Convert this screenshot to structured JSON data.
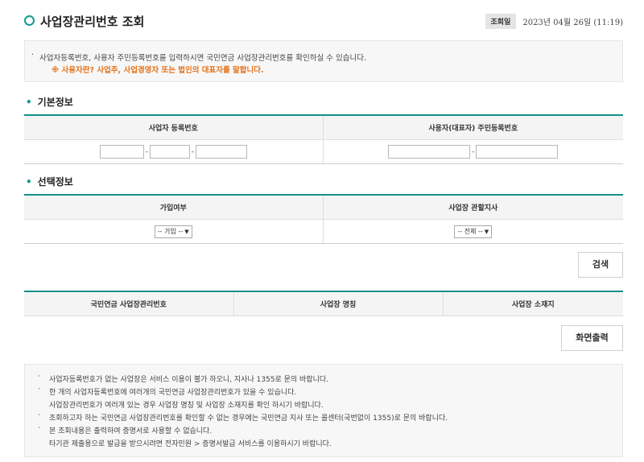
{
  "header": {
    "title": "사업장관리번호 조회",
    "meta_label": "조회일",
    "meta_date": "2023년 04월 26일 (11:19)"
  },
  "notice": {
    "bullet": "·",
    "line1": "사업자등록번호, 사용자 주민등록번호를 입력하시면 국민연금 사업장관리번호를 확인하실 수 있습니다.",
    "line2": "※ 사용자란? 사업주, 사업경영자 또는 법인의 대표자를 말합니다."
  },
  "basic": {
    "title": "기본정보",
    "col1": "사업자 등록번호",
    "col2": "사용자(대표자) 주민등록번호",
    "dash": "-"
  },
  "select_info": {
    "title": "선택정보",
    "col1": "가입여부",
    "col2": "사업장 관할지사",
    "join_select": "-- 가입 --",
    "branch_select": "-- 전체 --"
  },
  "search_button": "검색",
  "results": {
    "col1": "국민연금 사업장관리번호",
    "col2": "사업장 명칭",
    "col3": "사업장 소재지"
  },
  "print_button": "화면출력",
  "footer": {
    "bullet": "·",
    "lines": [
      "사업자등록번호가 없는 사업장은 서비스 이용이 불가 하오니, 지사나 1355로 문의 바랍니다.",
      "한 개의 사업자등록번호에 여러개의 국민연금 사업장관리번호가 있을 수 있습니다.",
      "사업장관리번호가 여러개 있는 경우 사업장 명칭 및 사업장 소재지를 확인 하시기 바랍니다.",
      "조회하고자 하는 국민연금 사업장관리번호를 확인할 수 없는 경우에는 국민연금 지사 또는 콜센터(국번없이 1355)로 문의 바랍니다.",
      "본 조회내용은 출력하여 증명서로 사용할 수 없습니다.",
      "타기관 제출용으로 발급을 받으시려면 전자민원 > 증명서발급 서비스를 이용하시기 바랍니다."
    ]
  },
  "colors": {
    "accent": "#149b8f",
    "warning": "#e4731c"
  }
}
